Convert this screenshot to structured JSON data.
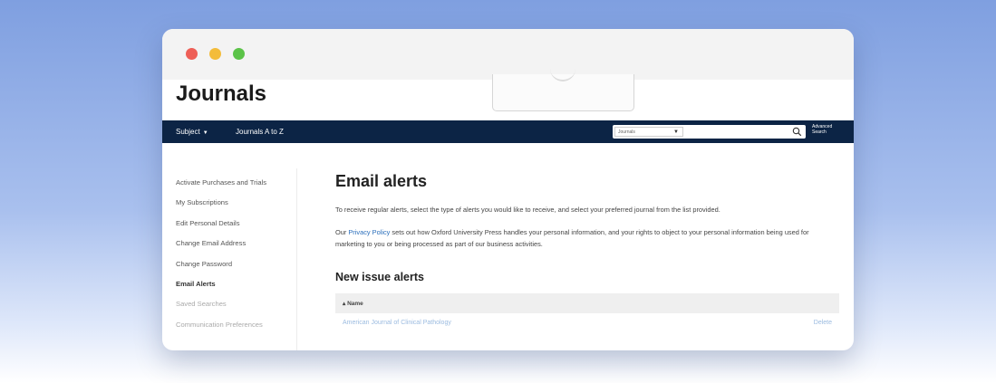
{
  "window": {
    "controls": [
      "close",
      "minimize",
      "maximize"
    ]
  },
  "site": {
    "title": "Journals"
  },
  "nav": {
    "subject_label": "Subject",
    "subject_caret": "▼",
    "journals_atoz": "Journals A to Z",
    "search": {
      "select_value": "Journals",
      "select_caret": "▼",
      "placeholder": "",
      "icon": "search-icon"
    },
    "advanced_search_line1": "Advanced",
    "advanced_search_line2": "Search"
  },
  "sidebar": {
    "items": [
      {
        "label": "Activate Purchases and Trials"
      },
      {
        "label": "My Subscriptions"
      },
      {
        "label": "Edit Personal Details"
      },
      {
        "label": "Change Email Address"
      },
      {
        "label": "Change Password"
      },
      {
        "label": "Email Alerts"
      },
      {
        "label": "Saved Searches"
      },
      {
        "label": "Communication Preferences"
      }
    ],
    "active_index": 5
  },
  "main": {
    "title": "Email alerts",
    "intro": "To receive regular alerts, select the type of alerts you would like to receive, and select your preferred journal from the list provided.",
    "privacy_prefix": "Our ",
    "privacy_link": "Privacy Policy",
    "privacy_suffix": " sets out how Oxford University Press handles your personal information, and your rights to object to your personal information being used for marketing to you or being processed as part of our business activities.",
    "section_title": "New issue alerts",
    "table": {
      "header_name": "Name",
      "sort_indicator": "▴",
      "rows": [
        {
          "journal": "American Journal of Clinical Pathology",
          "action": "Delete"
        }
      ]
    }
  },
  "colors": {
    "navbar": "#0c2445",
    "link": "#2a6ebb",
    "close": "#ee5f57",
    "minimize": "#f3bc3a",
    "maximize": "#5bc348"
  }
}
